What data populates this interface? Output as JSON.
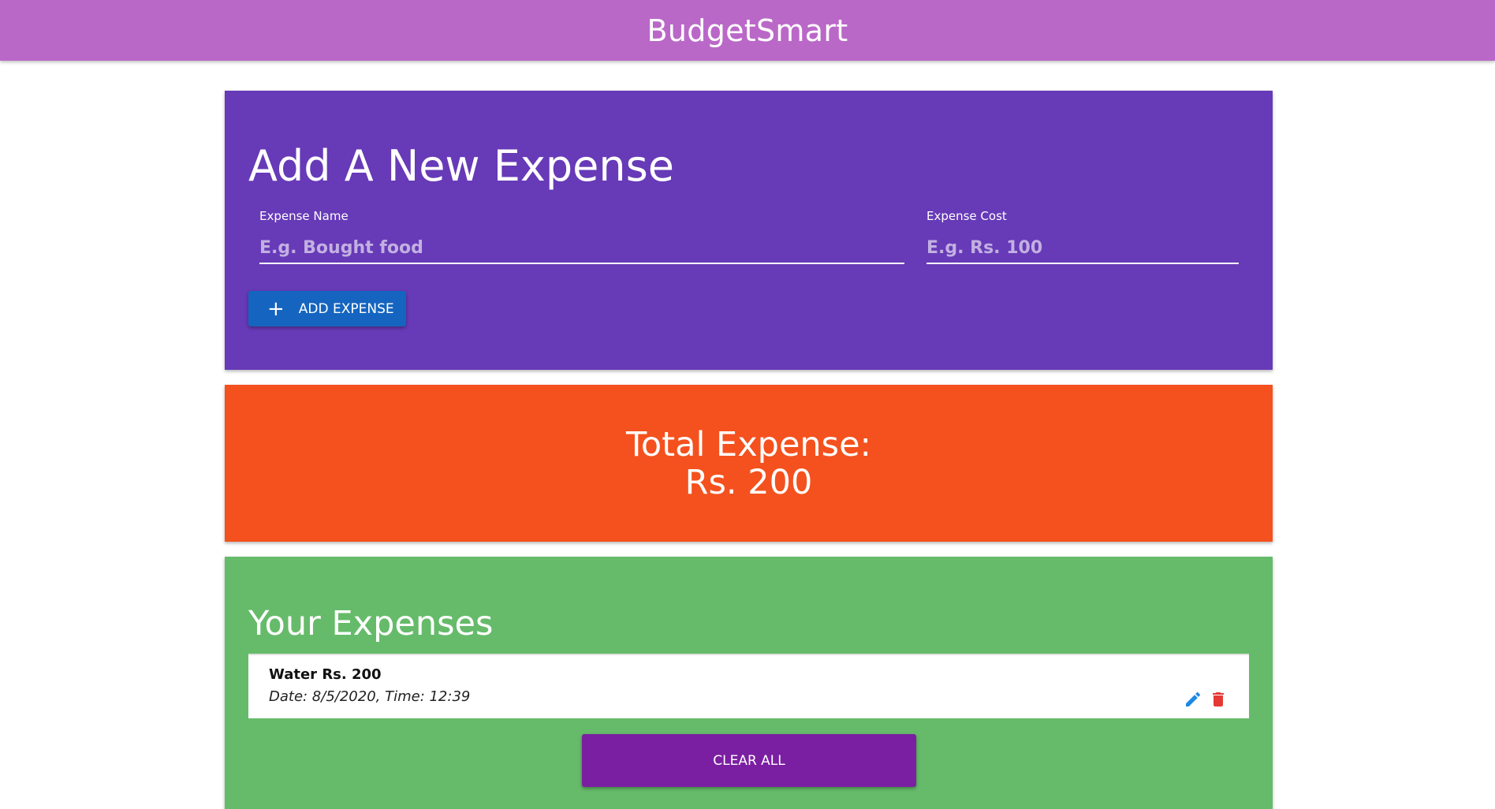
{
  "app": {
    "title": "BudgetSmart",
    "colors": {
      "app_bar": "#ba68c8",
      "add_card": "#673ab7",
      "total_card": "#f4511e",
      "list_card": "#66bb6a",
      "add_button": "#1565c0",
      "clear_button": "#7b1fa2",
      "edit_icon": "#1e88e5",
      "delete_icon": "#e53935"
    }
  },
  "add_form": {
    "heading": "Add A New Expense",
    "name_label": "Expense Name",
    "name_placeholder": "E.g. Bought food",
    "name_value": "",
    "cost_label": "Expense Cost",
    "cost_placeholder": "E.g. Rs. 100",
    "cost_value": "",
    "add_button_icon": "plus-icon",
    "add_button_label": "ADD EXPENSE"
  },
  "total": {
    "label": "Total Expense:",
    "value": "Rs. 200"
  },
  "expenses": {
    "heading": "Your Expenses",
    "items": [
      {
        "title": "Water Rs. 200",
        "date": "Date: 8/5/2020, Time: 12:39",
        "actions": [
          "edit-icon",
          "delete-icon"
        ]
      }
    ],
    "clear_label": "CLEAR ALL"
  }
}
